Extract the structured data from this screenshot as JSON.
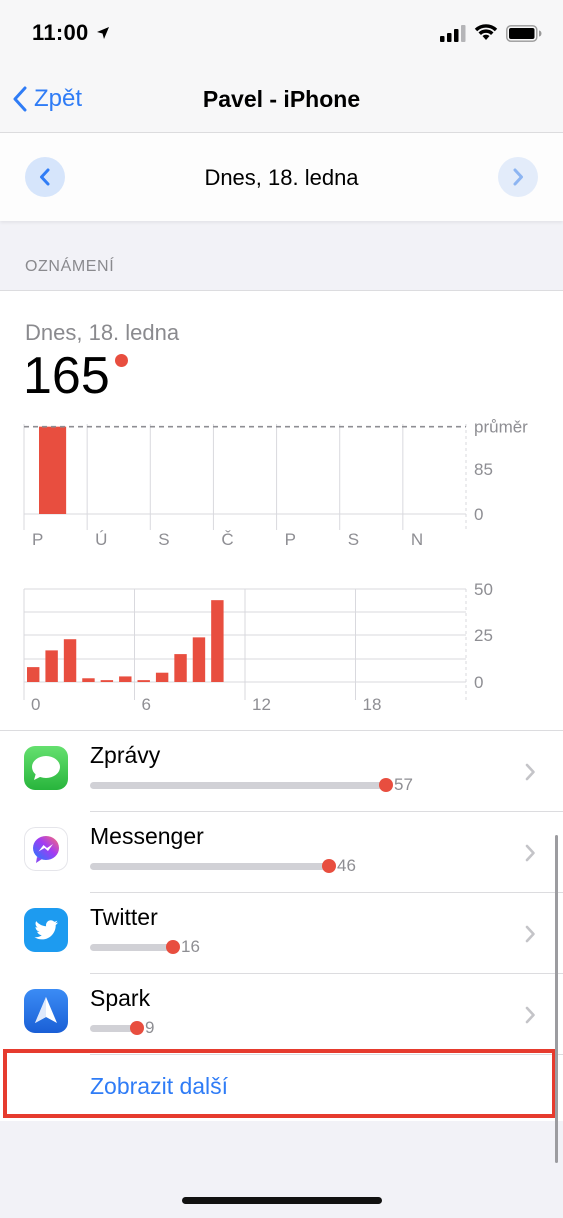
{
  "status_bar": {
    "time": "11:00"
  },
  "nav": {
    "back_label": "Zpět",
    "title": "Pavel - iPhone"
  },
  "date_nav": {
    "label": "Dnes, 18. ledna"
  },
  "section": {
    "title": "OZNÁMENÍ"
  },
  "summary": {
    "date": "Dnes, 18. ledna",
    "count": "165"
  },
  "colors": {
    "accent": "#2f7cf6",
    "bar": "#e84e3f",
    "grid": "#d9d9de"
  },
  "chart_data": [
    {
      "type": "bar",
      "categories": [
        "P",
        "Ú",
        "S",
        "Č",
        "P",
        "S",
        "N"
      ],
      "values": [
        165,
        0,
        0,
        0,
        0,
        0,
        0
      ],
      "y_ticks": [
        "průměr",
        "85",
        "0"
      ],
      "average": 165,
      "ylim": [
        0,
        170
      ]
    },
    {
      "type": "bar",
      "x": [
        0,
        1,
        2,
        3,
        4,
        5,
        6,
        7,
        8,
        9,
        10,
        11,
        12,
        13,
        14,
        15,
        16,
        17,
        18,
        19,
        20,
        21,
        22,
        23
      ],
      "x_ticks": [
        "0",
        "6",
        "12",
        "18"
      ],
      "values": [
        8,
        17,
        23,
        2,
        1,
        3,
        1,
        5,
        15,
        24,
        44,
        0,
        0,
        0,
        0,
        0,
        0,
        0,
        0,
        0,
        0,
        0,
        0,
        0
      ],
      "y_ticks": [
        "50",
        "25",
        "0"
      ],
      "ylim": [
        0,
        50
      ]
    }
  ],
  "apps": [
    {
      "name": "Zprávy",
      "count": "57",
      "value": 57,
      "icon": "messages-icon"
    },
    {
      "name": "Messenger",
      "count": "46",
      "value": 46,
      "icon": "messenger-icon"
    },
    {
      "name": "Twitter",
      "count": "16",
      "value": 16,
      "icon": "twitter-icon"
    },
    {
      "name": "Spark",
      "count": "9",
      "value": 9,
      "icon": "spark-icon"
    }
  ],
  "show_more": {
    "label": "Zobrazit další"
  }
}
